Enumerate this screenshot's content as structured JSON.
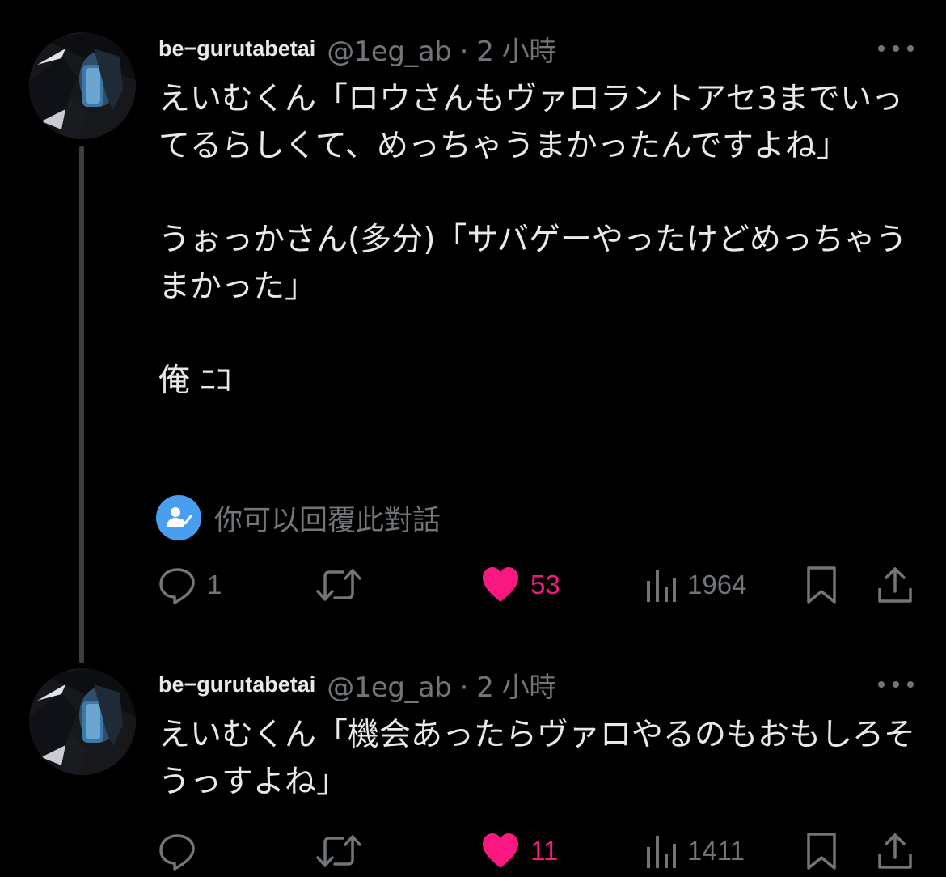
{
  "tweets": [
    {
      "name": "be−gurutabetai",
      "handle": "@1eg_ab · 2 小時",
      "paragraphs": [
        "えいむくん「ロウさんもヴァロラントアセ3までいってるらしくて、めっちゃうまかったんですよね」",
        "うぉっかさん(多分)「サバゲーやったけどめっちゃうまかった」",
        "俺 ﾆｺ"
      ],
      "reply_notice": "你可以回覆此對話",
      "actions": {
        "reply_count": "1",
        "retweet_count": "",
        "like_count": "53",
        "views_count": "1964"
      }
    },
    {
      "name": "be−gurutabetai",
      "handle": "@1eg_ab · 2 小時",
      "paragraphs": [
        "えいむくん「機会あったらヴァロやるのもおもしろそうっすよね」"
      ],
      "actions": {
        "reply_count": "",
        "retweet_count": "",
        "like_count": "11",
        "views_count": "1411"
      }
    }
  ],
  "colors": {
    "text": "#e7e9ea",
    "muted": "#71767b",
    "like": "#f91880",
    "reply_badge": "#4a9ef0",
    "background": "#000000"
  },
  "icons": [
    "more-icon",
    "reply-icon",
    "retweet-icon",
    "heart-icon",
    "views-icon",
    "bookmark-icon",
    "share-icon",
    "person-check-icon"
  ]
}
